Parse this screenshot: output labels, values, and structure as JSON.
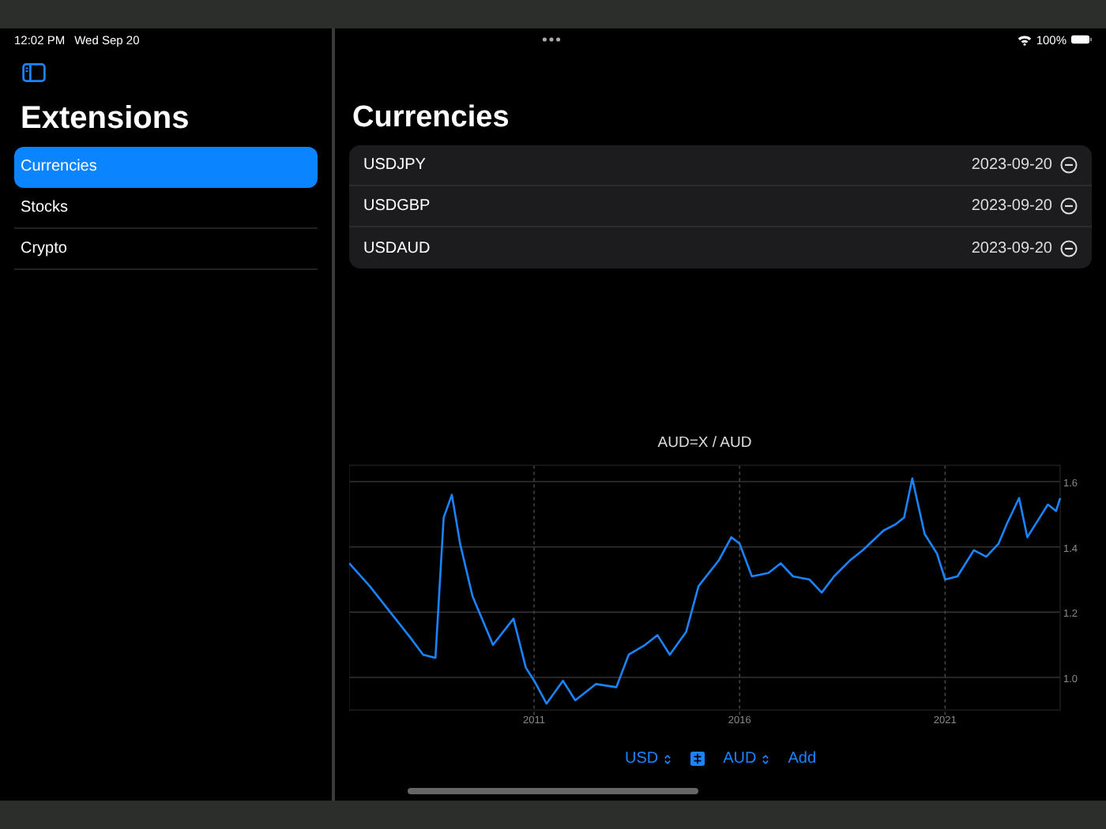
{
  "status_bar": {
    "time": "12:02 PM",
    "date": "Wed Sep 20",
    "battery": "100%"
  },
  "sidebar": {
    "title": "Extensions",
    "items": [
      {
        "label": "Currencies",
        "selected": true
      },
      {
        "label": "Stocks",
        "selected": false
      },
      {
        "label": "Crypto",
        "selected": false
      }
    ]
  },
  "main": {
    "title": "Currencies",
    "rows": [
      {
        "symbol": "USDJPY",
        "date": "2023-09-20"
      },
      {
        "symbol": "USDGBP",
        "date": "2023-09-20"
      },
      {
        "symbol": "USDAUD",
        "date": "2023-09-20"
      }
    ],
    "chart_data": {
      "type": "line",
      "title": "AUD=X / AUD",
      "grid": true,
      "xlim": [
        2006.5,
        2023.8
      ],
      "ylim": [
        0.9,
        1.65
      ],
      "xticks": [
        2011,
        2016,
        2021
      ],
      "yticks": [
        {
          "value": 1,
          "label": "1.0"
        },
        1.2,
        1.4,
        1.6
      ],
      "x": [
        2006.5,
        2007.0,
        2007.5,
        2008.0,
        2008.3,
        2008.6,
        2008.8,
        2009.0,
        2009.2,
        2009.5,
        2010.0,
        2010.5,
        2010.8,
        2011.0,
        2011.3,
        2011.7,
        2012.0,
        2012.5,
        2013.0,
        2013.3,
        2013.7,
        2014.0,
        2014.3,
        2014.7,
        2015.0,
        2015.5,
        2015.8,
        2016.0,
        2016.3,
        2016.7,
        2017.0,
        2017.3,
        2017.7,
        2018.0,
        2018.3,
        2018.7,
        2019.0,
        2019.5,
        2019.8,
        2020.0,
        2020.2,
        2020.5,
        2020.8,
        2021.0,
        2021.3,
        2021.7,
        2022.0,
        2022.3,
        2022.5,
        2022.8,
        2023.0,
        2023.3,
        2023.5,
        2023.7,
        2023.8
      ],
      "series": [
        {
          "color": "#1a84ff",
          "values": [
            1.35,
            1.28,
            1.2,
            1.12,
            1.07,
            1.06,
            1.49,
            1.56,
            1.41,
            1.25,
            1.1,
            1.18,
            1.03,
            0.99,
            0.92,
            0.99,
            0.93,
            0.98,
            0.97,
            1.07,
            1.1,
            1.13,
            1.07,
            1.14,
            1.28,
            1.36,
            1.43,
            1.41,
            1.31,
            1.32,
            1.35,
            1.31,
            1.3,
            1.26,
            1.31,
            1.36,
            1.39,
            1.45,
            1.47,
            1.49,
            1.61,
            1.44,
            1.38,
            1.3,
            1.31,
            1.39,
            1.37,
            1.41,
            1.47,
            1.55,
            1.43,
            1.49,
            1.53,
            1.51,
            1.55
          ]
        }
      ]
    }
  },
  "controls": {
    "base": "USD",
    "quote": "AUD",
    "add": "Add"
  }
}
